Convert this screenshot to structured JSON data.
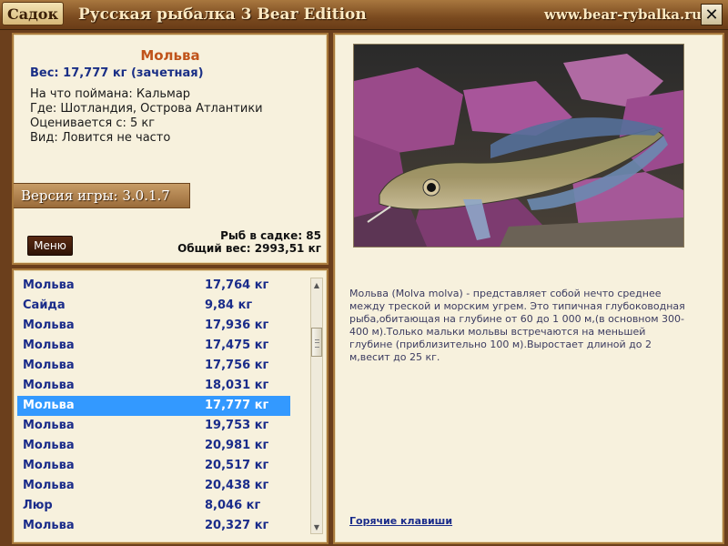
{
  "titlebar": {
    "tab_label": "Садок",
    "app_title": "Русская рыбалка 3 Bear Edition",
    "site_url": "www.bear-rybalka.ru",
    "close_glyph": "✕"
  },
  "fish_info": {
    "name": "Мольва",
    "weight_line": "Вес: 17,777 кг (зачетная)",
    "bait_line": "На что поймана: Кальмар",
    "location_line": "Где: Шотландия, Острова Атлантики",
    "rated_line": "Оценивается с: 5 кг",
    "frequency_line": "Вид: Ловится не часто"
  },
  "version_label": "Версия игры: 3.0.1.7",
  "menu_label": "Меню",
  "stats": {
    "fish_count_line": "Рыб в садке: 85",
    "total_weight_line": "Общий вес: 2993,51 кг"
  },
  "catch_list": {
    "selected_index": 6,
    "rows": [
      {
        "name": "Мольва",
        "weight": "17,764 кг"
      },
      {
        "name": "Сайда",
        "weight": "9,84 кг"
      },
      {
        "name": "Мольва",
        "weight": "17,936 кг"
      },
      {
        "name": "Мольва",
        "weight": "17,475 кг"
      },
      {
        "name": "Мольва",
        "weight": "17,756 кг"
      },
      {
        "name": "Мольва",
        "weight": "18,031 кг"
      },
      {
        "name": "Мольва",
        "weight": "17,777 кг"
      },
      {
        "name": "Мольва",
        "weight": "19,753 кг"
      },
      {
        "name": "Мольва",
        "weight": "20,981 кг"
      },
      {
        "name": "Мольва",
        "weight": "20,517 кг"
      },
      {
        "name": "Мольва",
        "weight": "20,438 кг"
      },
      {
        "name": "Люр",
        "weight": "8,046 кг"
      },
      {
        "name": "Мольва",
        "weight": "20,327 кг"
      }
    ]
  },
  "scrollbar": {
    "up_glyph": "▲",
    "down_glyph": "▼"
  },
  "description": "Мольва (Molva molva) - представляет собой нечто среднее между треской и морским угрем. Это типичная глубоководная рыба,обитающая на глубине от 60 до 1 000 м,(в основном 300-400 м).Только мальки мольвы встречаются на меньшей глубине (приблизительно 100 м).Выростает длиной до 2 м,весит до 25 кг.",
  "hotkeys_label": "Горячие клавиши"
}
